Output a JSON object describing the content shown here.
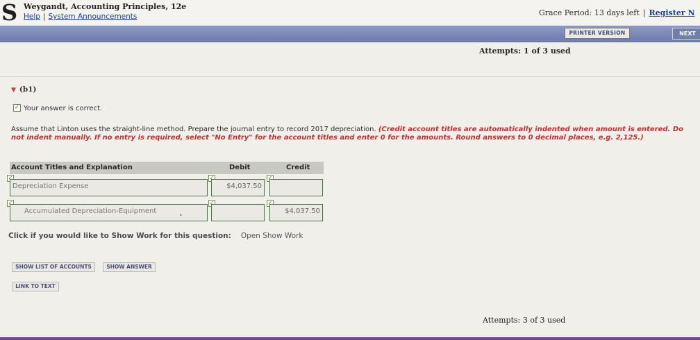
{
  "header": {
    "logo": "S",
    "title": "Weygandt, Accounting Principles, 12e",
    "links": [
      "Help",
      "System Announcements"
    ],
    "link_sep": "|",
    "grace": "Grace Period: 13 days left",
    "register": "Register N"
  },
  "toolbar": {
    "printer": "PRINTER VERSION",
    "next": "NEXT"
  },
  "attempts_top": "Attempts: 1 of 3 used",
  "question": {
    "label": "(b1)",
    "correct": "Your answer is correct.",
    "instruction": "Assume that Linton uses the straight-line method. Prepare the journal entry to record 2017 depreciation.",
    "instruction_red": "(Credit account titles are automatically indented when amount is entered. Do not indent manually. If no entry is required, select \"No Entry\" for the account titles and enter 0 for the amounts. Round answers to 0 decimal places, e.g. 2,125.)"
  },
  "journal": {
    "headers": {
      "account": "Account Titles and Explanation",
      "debit": "Debit",
      "credit": "Credit"
    },
    "rows": [
      {
        "account": "Depreciation Expense",
        "debit": "$4,037.50",
        "credit": ""
      },
      {
        "account": "Accumulated Depreciation-Equipment",
        "debit": "",
        "credit": "$4,037.50"
      }
    ]
  },
  "showwork": {
    "question": "Click if you would like to Show Work for this question:",
    "link": "Open Show Work"
  },
  "buttons": {
    "list": "SHOW LIST OF ACCOUNTS",
    "answer": "SHOW ANSWER",
    "link_text": "LINK TO TEXT"
  },
  "attempts_bottom": "Attempts: 3 of 3 used",
  "icons": {
    "check": "✓",
    "caret": "▼",
    "dot": "•"
  }
}
